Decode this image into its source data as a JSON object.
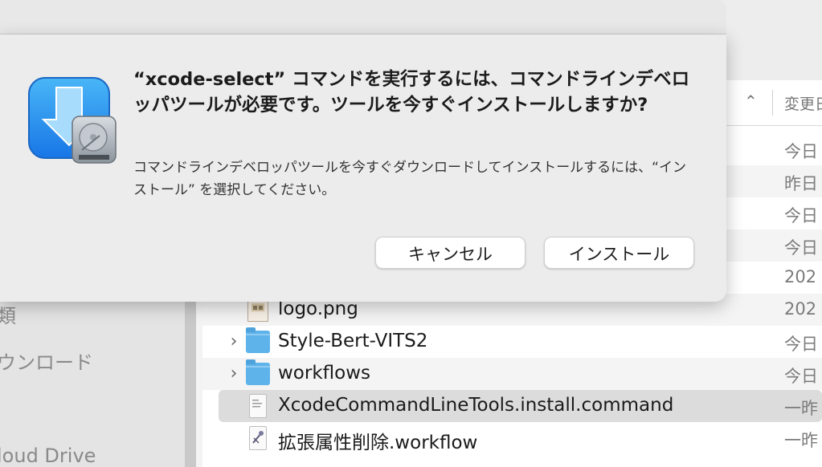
{
  "dialog": {
    "headline": "“xcode-select” コマンドを実行するには、コマンドラインデベロッパツールが必要です。ツールを今すぐインストールしますか?",
    "body": "コマンドラインデベロッパツールを今すぐダウンロードしてインストールするには、“インストール” を選択してください。",
    "cancel_label": "キャンセル",
    "install_label": "インストール",
    "icon": "xcode-installer-icon"
  },
  "sidebar": {
    "items": [
      {
        "label": "類"
      },
      {
        "label": "ウンロード"
      },
      {
        "label": "loud Drive"
      }
    ]
  },
  "filelist": {
    "sort_icon": "chevron-up-icon",
    "date_column": "変更日",
    "rows": [
      {
        "date": "今日"
      },
      {
        "date": "昨日"
      },
      {
        "date": "今日"
      },
      {
        "date": "今日"
      },
      {
        "date": "202"
      },
      {
        "name": "logo.png",
        "date": "202",
        "icon": "png-file-icon"
      },
      {
        "name": "Style-Bert-VITS2",
        "date": "今日",
        "icon": "folder-icon"
      },
      {
        "name": "workflows",
        "date": "今日",
        "icon": "folder-icon"
      },
      {
        "name": "XcodeCommandLineTools.install.command",
        "date": "一昨",
        "icon": "script-file-icon"
      },
      {
        "name": "拡張属性削除.workflow",
        "date": "一昨",
        "icon": "automator-workflow-icon"
      }
    ]
  }
}
